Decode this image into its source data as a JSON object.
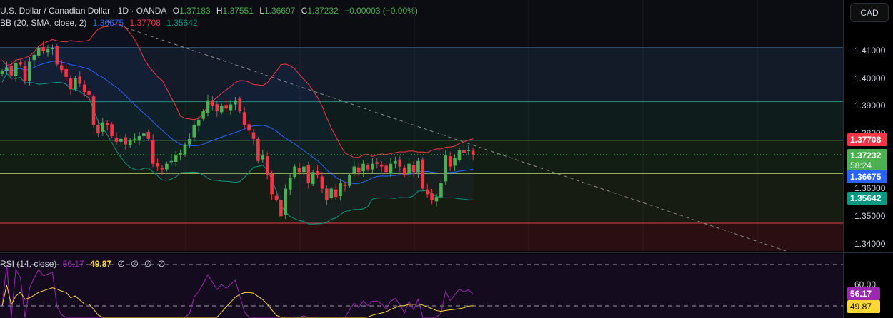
{
  "header": {
    "symbol": "U.S. Dollar / Canadian Dollar · 1D · OANDA",
    "open_label": "O",
    "open": "1.37183",
    "high_label": "H",
    "high": "1.37551",
    "low_label": "L",
    "low": "1.36697",
    "close_label": "C",
    "close": "1.37232",
    "change": "−0.00003 (−0.00%)"
  },
  "bb": {
    "label": "BB (20, SMA, close, 2)",
    "basis": "1.36675",
    "upper": "1.37708",
    "lower": "1.35642"
  },
  "rsi": {
    "label": "RSI (14, close)",
    "value": "56.17",
    "ma": "49.87",
    "extras": [
      "∅",
      "∅",
      "∅",
      "∅"
    ]
  },
  "currency_button": "CAD",
  "price_axis": [
    "1.41000",
    "1.40000",
    "1.39000",
    "1.38000",
    "1.36000",
    "1.35000",
    "1.34000"
  ],
  "price_tags": {
    "upper": "1.37708",
    "last": "1.37232",
    "countdown": "58:24",
    "basis": "1.36675",
    "lower": "1.35642"
  },
  "rsi_axis": [
    "60.00"
  ],
  "rsi_tags": {
    "rsi": "56.17",
    "ma": "49.87"
  },
  "colors": {
    "up": "#4caf50",
    "down": "#f23645",
    "bb_upper": "#f23645",
    "bb_basis": "#2962ff",
    "bb_lower": "#089981",
    "rsi": "#9c27b0",
    "rsi_ma": "#fdd835"
  },
  "chart_data": {
    "type": "candlestick",
    "ylim": [
      1.335,
      1.42
    ],
    "levels": [
      1.411,
      1.3915,
      1.3775,
      1.3655,
      1.3475
    ],
    "closes": [
      1.4025,
      1.404,
      1.401,
      1.4055,
      1.405,
      1.399,
      1.406,
      1.4085,
      1.411,
      1.41,
      1.4105,
      1.411,
      1.405,
      1.403,
      1.4005,
      1.396,
      1.4,
      1.398,
      1.395,
      1.394,
      1.383,
      1.38,
      1.384,
      1.383,
      1.379,
      1.377,
      1.378,
      1.376,
      1.3775,
      1.378,
      1.379,
      1.38,
      1.378,
      1.369,
      1.368,
      1.367,
      1.369,
      1.37,
      1.372,
      1.373,
      1.376,
      1.378,
      1.383,
      1.385,
      1.388,
      1.392,
      1.39,
      1.388,
      1.39,
      1.389,
      1.3905,
      1.392,
      1.388,
      1.383,
      1.381,
      1.378,
      1.37,
      1.372,
      1.365,
      1.358,
      1.356,
      1.35,
      1.36,
      1.364,
      1.368,
      1.366,
      1.368,
      1.362,
      1.366,
      1.365,
      1.36,
      1.356,
      1.36,
      1.357,
      1.362,
      1.361,
      1.365,
      1.368,
      1.366,
      1.369,
      1.367,
      1.369,
      1.369,
      1.368,
      1.366,
      1.369,
      1.37,
      1.368,
      1.365,
      1.369,
      1.366,
      1.37,
      1.36,
      1.358,
      1.356,
      1.357,
      1.362,
      1.372,
      1.368,
      1.371,
      1.374,
      1.373,
      1.374,
      1.3723
    ],
    "rsi_range": [
      0,
      100
    ]
  }
}
